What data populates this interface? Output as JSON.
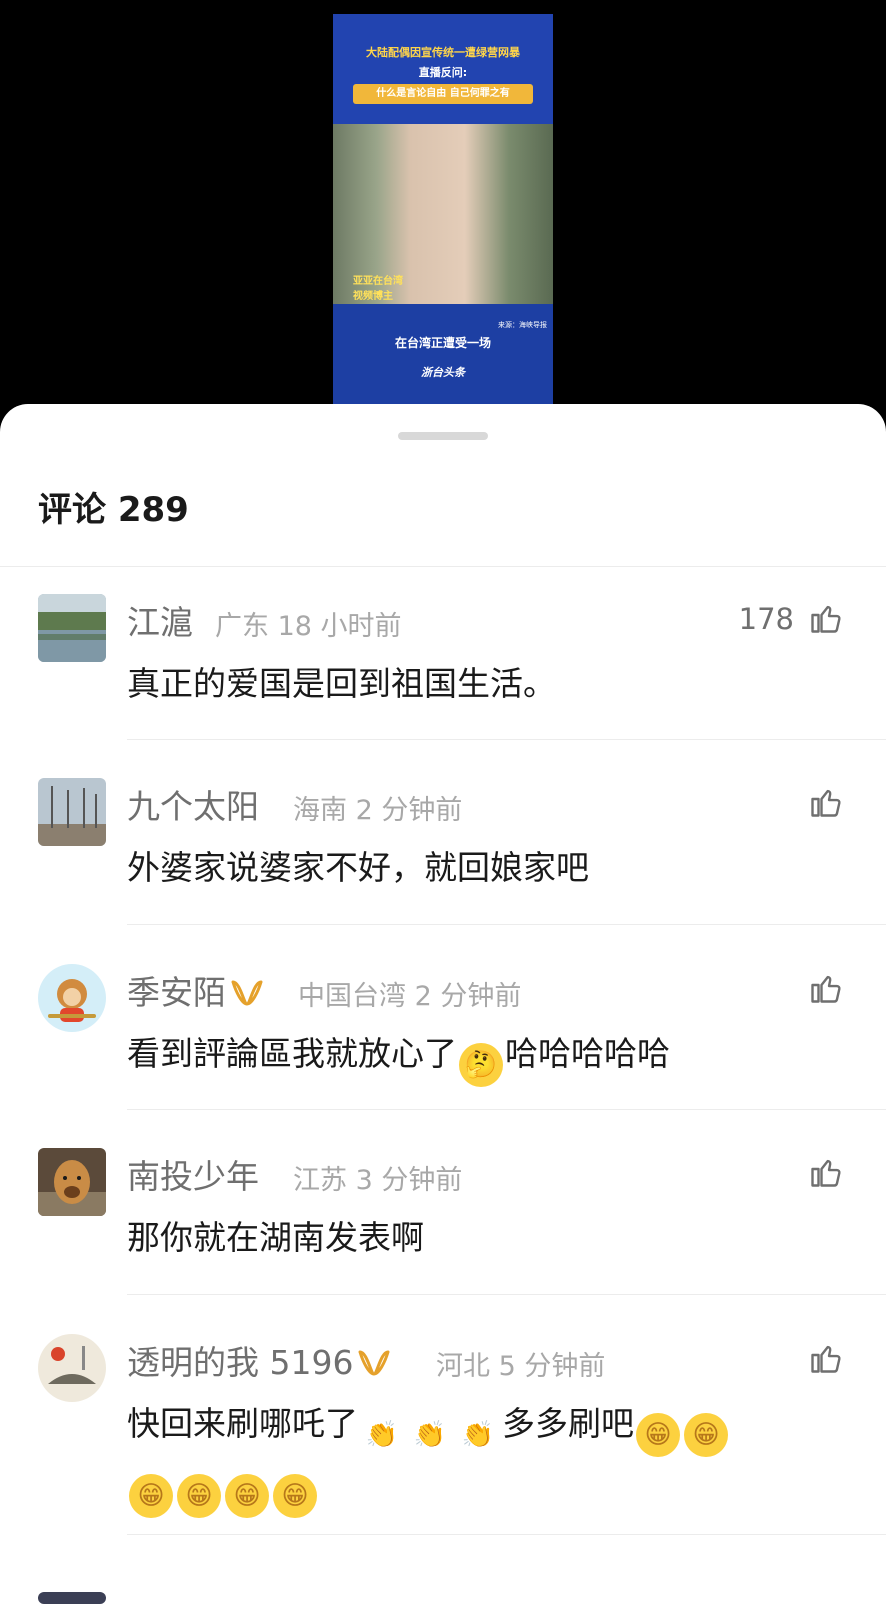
{
  "video": {
    "headline": "大陆配偶因宣传统一遭绿营网暴",
    "subhead": "直播反问:",
    "banner": "什么是言论自由 自己何罪之有",
    "caption_line1": "亚亚在台湾",
    "caption_line2": "视频博主",
    "source": "来源：海峡导报",
    "subtitle": "在台湾正遭受一场",
    "logo": "浙台头条"
  },
  "comments_panel": {
    "title": "评论 289"
  },
  "comments": [
    {
      "name": "江滬",
      "badge": "",
      "region": "广东",
      "time": "18 小时前",
      "likes": "178",
      "text": "真正的爱国是回到祖国生活。"
    },
    {
      "name": "九个太阳",
      "badge": "",
      "region": "海南",
      "time": "2 分钟前",
      "likes": "",
      "text": "外婆家说婆家不好，就回娘家吧"
    },
    {
      "name": "季安陌",
      "badge": "V",
      "region": "中国台湾",
      "time": "2 分钟前",
      "likes": "",
      "text": "看到評論區我就放心了"
    },
    {
      "name": "南投少年",
      "badge": "",
      "region": "江苏",
      "time": "3 分钟前",
      "likes": "",
      "text": "那你就在湖南发表啊"
    },
    {
      "name": "透明的我 5196",
      "badge": "V",
      "region": "河北",
      "time": "5 分钟前",
      "likes": "",
      "text": "快回来刷哪吒了"
    }
  ],
  "comment3_suffix": "哈哈哈哈哈",
  "comment5_mid": "多多刷吧",
  "icons": {
    "like": "thumbs-up-icon",
    "emoji_think": "thinking-face-icon",
    "emoji_clap": "clapping-hands-icon",
    "emoji_grin": "grinning-face-icon"
  },
  "colors": {
    "accent_badge": "#e5a12b",
    "meta": "#a8a8a8",
    "name": "#6f6f6f"
  }
}
